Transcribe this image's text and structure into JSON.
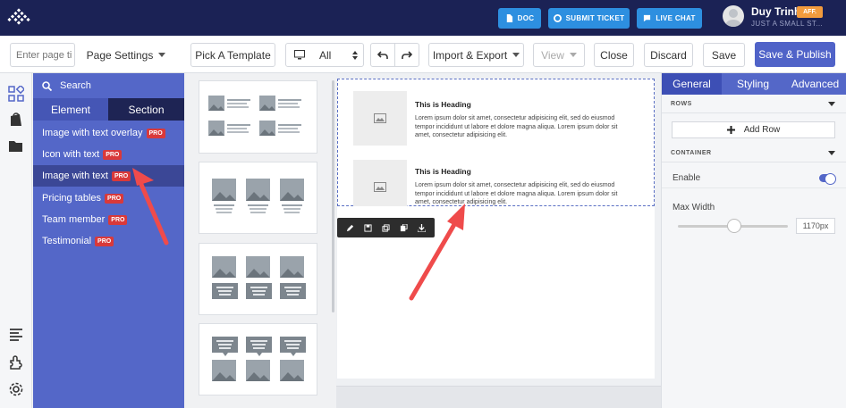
{
  "topbar": {
    "buttons": [
      {
        "label": "DOC",
        "icon": "doc-icon"
      },
      {
        "label": "SUBMIT TICKET",
        "icon": "lifebuoy-icon"
      },
      {
        "label": "LIVE CHAT",
        "icon": "chat-icon"
      }
    ],
    "user": {
      "name": "Duy Trinh",
      "badge": "AFF.",
      "subtitle": "JUST A SMALL ST..."
    }
  },
  "toolbar": {
    "page_title_placeholder": "Enter page ti",
    "page_settings": "Page Settings",
    "pick_template": "Pick A Template",
    "device": "All",
    "import_export": "Import & Export",
    "view": "View",
    "close": "Close",
    "discard": "Discard",
    "save": "Save",
    "save_publish": "Save & Publish"
  },
  "element_panel": {
    "search_label": "Search",
    "tabs": {
      "element": "Element",
      "section": "Section"
    },
    "items": [
      {
        "label": "Image with text overlay",
        "badge": "PRO"
      },
      {
        "label": "Icon with text",
        "badge": "PRO"
      },
      {
        "label": "Image with text",
        "badge": "PRO",
        "active": true
      },
      {
        "label": "Pricing tables",
        "badge": "PRO"
      },
      {
        "label": "Team member",
        "badge": "PRO"
      },
      {
        "label": "Testimonial",
        "badge": "PRO"
      }
    ]
  },
  "canvas": {
    "blocks": [
      {
        "heading": "This is Heading",
        "text": "Lorem ipsum dolor sit amet, consectetur adipisicing elit, sed do eiusmod tempor incididunt ut labore et dolore magna aliqua. Lorem ipsum dolor sit amet, consectetur adipisicing elit."
      },
      {
        "heading": "This is Heading",
        "text": "Lorem ipsum dolor sit amet, consectetur adipisicing elit, sed do eiusmod tempor incididunt ut labore et dolore magna aliqua. Lorem ipsum dolor sit amet, consectetur adipisicing elit."
      }
    ]
  },
  "right_panel": {
    "tabs": {
      "general": "General",
      "styling": "Styling",
      "advanced": "Advanced"
    },
    "rows_header": "ROWS",
    "add_row": "Add Row",
    "container_header": "CONTAINER",
    "enable_label": "Enable",
    "enable_value": true,
    "max_width_label": "Max Width",
    "max_width_value": "1170px",
    "slider_fraction": 0.48
  },
  "colors": {
    "topbar": "#1b2255",
    "accent": "#5467c8",
    "button_blue": "#2d8fe0",
    "pro_badge": "#d9393a",
    "aff_badge": "#f29b3d",
    "arrow": "#ef4b4b"
  }
}
